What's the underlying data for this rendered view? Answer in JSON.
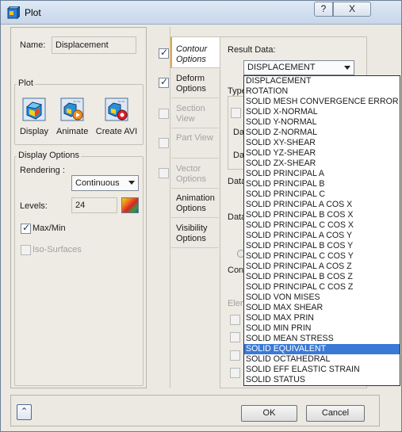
{
  "window": {
    "title": "Plot",
    "help_label": "?",
    "close_label": "X"
  },
  "name": {
    "label": "Name:",
    "value": "Displacement"
  },
  "plot_group": {
    "title": "Plot",
    "buttons": [
      {
        "label": "Display",
        "icon": "display-icon"
      },
      {
        "label": "Animate",
        "icon": "animate-icon"
      },
      {
        "label": "Create AVI",
        "icon": "create-avi-icon"
      }
    ]
  },
  "display_options": {
    "title": "Display Options",
    "rendering_label": "Rendering :",
    "rendering_value": "Continuous",
    "levels_label": "Levels:",
    "levels_value": "24",
    "maxmin_label": "Max/Min",
    "maxmin_checked": true,
    "iso_label": "Iso-Surfaces",
    "iso_checked": false
  },
  "tabs": [
    {
      "line1": "Contour",
      "line2": "Options",
      "checked": true,
      "active": true,
      "enabled": true
    },
    {
      "line1": "Deform",
      "line2": "Options",
      "checked": true,
      "active": false,
      "enabled": true
    },
    {
      "line1": "Section",
      "line2": "View",
      "checked": false,
      "active": false,
      "enabled": false
    },
    {
      "line1": "Part View",
      "line2": "",
      "checked": false,
      "active": false,
      "enabled": false
    },
    {
      "line1": "Vector",
      "line2": "Options",
      "checked": false,
      "active": false,
      "enabled": false
    },
    {
      "line1": "Animation",
      "line2": "Options",
      "checked": null,
      "active": false,
      "enabled": true
    },
    {
      "line1": "Visibility",
      "line2": "Options",
      "checked": null,
      "active": false,
      "enabled": true
    }
  ],
  "contour": {
    "result_label": "Result Data:",
    "result_value": "DISPLACEMENT",
    "partial_labels": {
      "type": "Type",
      "da1": "Da",
      "da2": "Da",
      "data1": "Data",
      "data2": "Data",
      "con": "Con",
      "elem": "Elem"
    },
    "options": [
      "DISPLACEMENT",
      "ROTATION",
      "SOLID MESH CONVERGENCE ERROR",
      "SOLID X-NORMAL",
      "SOLID Y-NORMAL",
      "SOLID Z-NORMAL",
      "SOLID XY-SHEAR",
      "SOLID YZ-SHEAR",
      "SOLID ZX-SHEAR",
      "SOLID PRINCIPAL A",
      "SOLID PRINCIPAL B",
      "SOLID PRINCIPAL C",
      "SOLID PRINCIPAL A COS X",
      "SOLID PRINCIPAL B COS X",
      "SOLID PRINCIPAL C COS X",
      "SOLID PRINCIPAL A COS Y",
      "SOLID PRINCIPAL B COS Y",
      "SOLID PRINCIPAL C COS Y",
      "SOLID PRINCIPAL A COS Z",
      "SOLID PRINCIPAL B COS Z",
      "SOLID PRINCIPAL C COS Z",
      "SOLID VON MISES",
      "SOLID MAX SHEAR",
      "SOLID MAX PRIN",
      "SOLID MIN PRIN",
      "SOLID MEAN STRESS",
      "SOLID EQUIVALENT",
      "SOLID OCTAHEDRAL",
      "SOLID EFF ELASTIC STRAIN",
      "SOLID STATUS"
    ],
    "highlighted_index": 26
  },
  "footer": {
    "ok_label": "OK",
    "cancel_label": "Cancel",
    "expand_label": "⌃"
  }
}
